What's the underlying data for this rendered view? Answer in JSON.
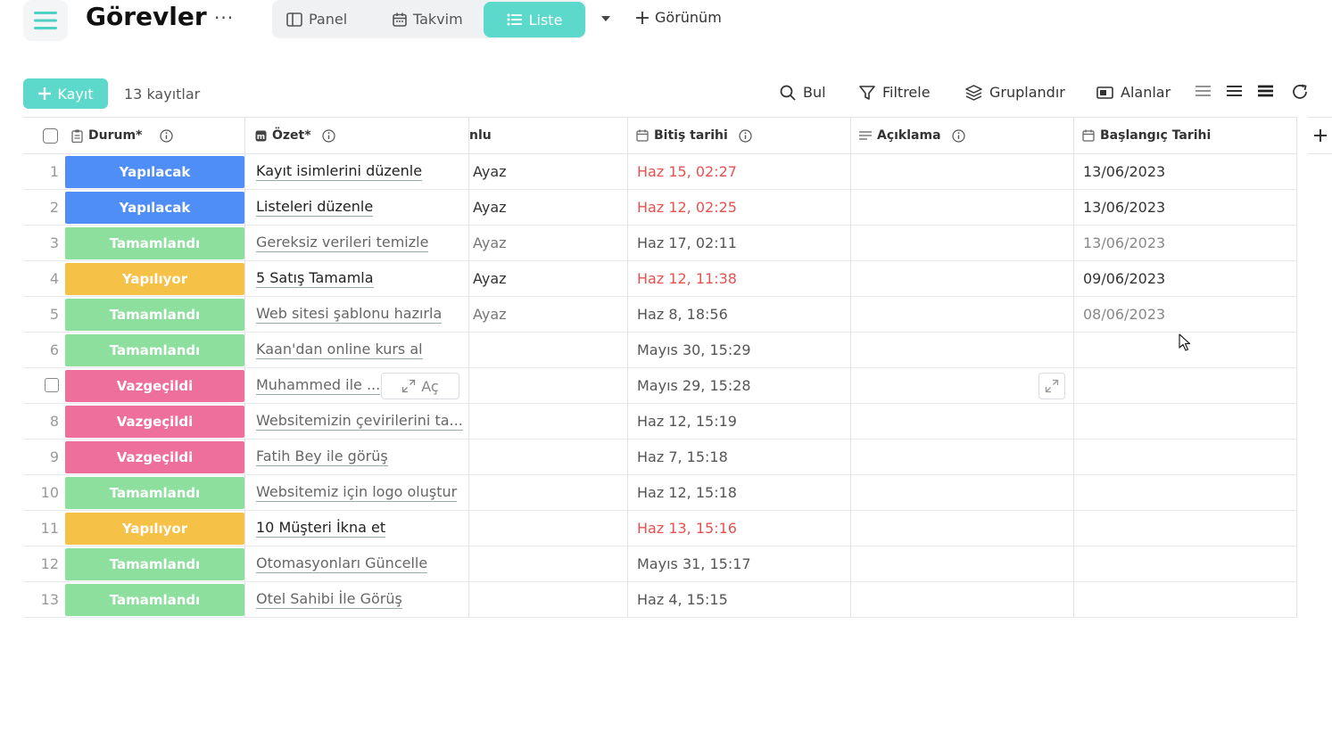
{
  "header": {
    "title": "Görevler",
    "more": "···",
    "tabs": [
      {
        "label": "Panel",
        "icon": "panel-icon"
      },
      {
        "label": "Takvim",
        "icon": "calendar-icon"
      },
      {
        "label": "Liste",
        "icon": "list-icon",
        "active": true
      }
    ],
    "add_view_label": "Görünüm"
  },
  "toolbar": {
    "add_record_label": "Kayıt",
    "record_count": "13 kayıtlar",
    "find_label": "Bul",
    "filter_label": "Filtrele",
    "group_label": "Gruplandır",
    "fields_label": "Alanlar"
  },
  "columns": {
    "status": "Durum*",
    "summary": "Özet*",
    "owner": "nlu",
    "due": "Bitiş tarihi",
    "description": "Açıklama",
    "start": "Başlangıç Tarihi"
  },
  "open_label": "Aç",
  "status_colors": {
    "Yapılacak": "#4f8ef7",
    "Tamamlandı": "#8ddf9e",
    "Yapılıyor": "#f5c146",
    "Vazgeçildi": "#ee6f9c"
  },
  "rows": [
    {
      "num": "1",
      "status": "Yapılacak",
      "summary": "Kayıt isimlerini düzenle",
      "owner": "Ayaz",
      "due": "Haz 15, 02:27",
      "due_late": true,
      "start": "13/06/2023",
      "done": false
    },
    {
      "num": "2",
      "status": "Yapılacak",
      "summary": "Listeleri düzenle",
      "owner": "Ayaz",
      "due": "Haz 12, 02:25",
      "due_late": true,
      "start": "13/06/2023",
      "done": false
    },
    {
      "num": "3",
      "status": "Tamamlandı",
      "summary": "Gereksiz verileri temizle",
      "owner": "Ayaz",
      "due": "Haz 17, 02:11",
      "due_late": false,
      "start": "13/06/2023",
      "done": true
    },
    {
      "num": "4",
      "status": "Yapılıyor",
      "summary": "5 Satış Tamamla",
      "owner": "Ayaz",
      "due": "Haz 12, 11:38",
      "due_late": true,
      "start": "09/06/2023",
      "done": false
    },
    {
      "num": "5",
      "status": "Tamamlandı",
      "summary": "Web sitesi şablonu hazırla",
      "owner": "Ayaz",
      "due": "Haz 8, 18:56",
      "due_late": false,
      "start": "08/06/2023",
      "done": true
    },
    {
      "num": "6",
      "status": "Tamamlandı",
      "summary": "Kaan'dan online kurs al",
      "owner": "",
      "due": "Mayıs 30, 15:29",
      "due_late": false,
      "start": "",
      "done": true
    },
    {
      "num": "",
      "status": "Vazgeçildi",
      "summary": "Muhammed ile ...",
      "owner": "",
      "due": "Mayıs 29, 15:28",
      "due_late": false,
      "start": "",
      "done": true,
      "hovered": true
    },
    {
      "num": "8",
      "status": "Vazgeçildi",
      "summary": "Websitemizin çevirilerini ta...",
      "owner": "",
      "due": "Haz 12, 15:19",
      "due_late": false,
      "start": "",
      "done": true
    },
    {
      "num": "9",
      "status": "Vazgeçildi",
      "summary": "Fatih Bey ile görüş",
      "owner": "",
      "due": "Haz 7, 15:18",
      "due_late": false,
      "start": "",
      "done": true
    },
    {
      "num": "10",
      "status": "Tamamlandı",
      "summary": "Websitemiz için logo oluştur",
      "owner": "",
      "due": "Haz 12, 15:18",
      "due_late": false,
      "start": "",
      "done": true
    },
    {
      "num": "11",
      "status": "Yapılıyor",
      "summary": "10 Müşteri İkna et",
      "owner": "",
      "due": "Haz 13, 15:16",
      "due_late": true,
      "start": "",
      "done": false
    },
    {
      "num": "12",
      "status": "Tamamlandı",
      "summary": "Otomasyonları Güncelle",
      "owner": "",
      "due": "Mayıs 31, 15:17",
      "due_late": false,
      "start": "",
      "done": true
    },
    {
      "num": "13",
      "status": "Tamamlandı",
      "summary": "Otel Sahibi İle Görüş",
      "owner": "",
      "due": "Haz 4, 15:15",
      "due_late": false,
      "start": "",
      "done": true
    }
  ]
}
